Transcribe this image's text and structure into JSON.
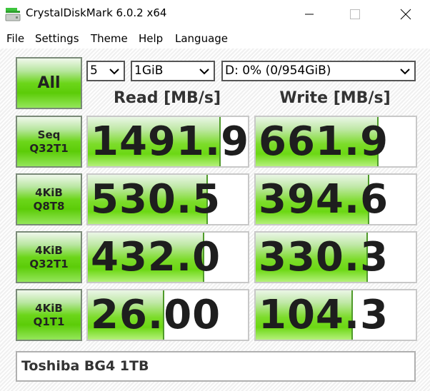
{
  "window": {
    "title": "CrystalDiskMark 6.0.2 x64",
    "icon": "app-disk-icon",
    "controls": [
      "minimize-icon",
      "maximize-icon",
      "close-icon"
    ]
  },
  "menu": {
    "items": [
      "File",
      "Settings",
      "Theme",
      "Help",
      "Language"
    ]
  },
  "controls": {
    "all_label": "All",
    "count_select": "5",
    "size_select": "1GiB",
    "drive_select": "D: 0% (0/954GiB)"
  },
  "headers": {
    "read": "Read [MB/s]",
    "write": "Write [MB/s]"
  },
  "rows": [
    {
      "line1": "Seq",
      "line2": "Q32T1",
      "read": "1491.9",
      "write": "661.9",
      "read_fill": 0.82,
      "write_fill": 0.76
    },
    {
      "line1": "4KiB",
      "line2": "Q8T8",
      "read": "530.5",
      "write": "394.6",
      "read_fill": 0.74,
      "write_fill": 0.7
    },
    {
      "line1": "4KiB",
      "line2": "Q32T1",
      "read": "432.0",
      "write": "330.3",
      "read_fill": 0.72,
      "write_fill": 0.69
    },
    {
      "line1": "4KiB",
      "line2": "Q1T1",
      "read": "26.00",
      "write": "104.3",
      "read_fill": 0.47,
      "write_fill": 0.6
    }
  ],
  "comment": "Toshiba BG4 1TB",
  "colors": {
    "accent_green": "#6cd814",
    "button_border": "#7a8a78",
    "text_dark": "#1e1e1e"
  }
}
